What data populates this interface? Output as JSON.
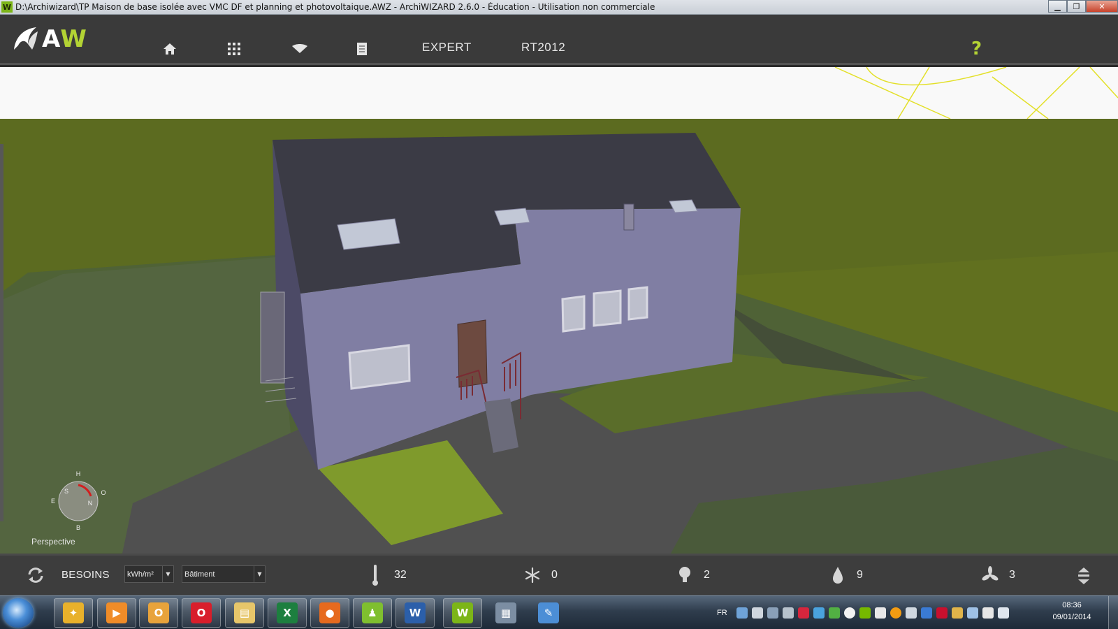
{
  "window": {
    "title": "D:\\Archiwizard\\TP Maison de base isolée avec VMC DF et planning et photovoltaique.AWZ  -  ArchiWIZARD 2.6.0 - Éducation - Utilisation non commerciale",
    "icon_letter": "W",
    "controls": {
      "minimize": "minimize-icon",
      "maximize": "maximize-icon",
      "close": "close-icon"
    }
  },
  "header": {
    "logo": {
      "letter_a": "A",
      "letter_w": "W"
    },
    "nav": [
      {
        "icon": "home-icon"
      },
      {
        "icon": "grid-icon"
      },
      {
        "icon": "eye-icon"
      },
      {
        "icon": "document-icon"
      },
      {
        "label": "EXPERT"
      },
      {
        "label": "RT2012"
      }
    ],
    "help": "?"
  },
  "viewport": {
    "compass": {
      "top": "H",
      "bottom": "B",
      "left": "E",
      "right": "O",
      "inner_s": "S",
      "inner_n": "N"
    },
    "view_label": "Perspective"
  },
  "bottom_bar": {
    "refresh_icon": "refresh-icon",
    "title": "BESOINS",
    "unit_select": "kWh/m²",
    "scope_select": "Bâtiment",
    "stats": [
      {
        "icon": "thermometer-icon",
        "value": "32"
      },
      {
        "icon": "snowflake-icon",
        "value": "0"
      },
      {
        "icon": "lightbulb-icon",
        "value": "2"
      },
      {
        "icon": "water-drop-icon",
        "value": "9"
      },
      {
        "icon": "fan-icon",
        "value": "3"
      }
    ],
    "expand_icon": "expand-icon"
  },
  "taskbar": {
    "apps": [
      {
        "name": "games",
        "letter": "✦",
        "color": "#e8b12b"
      },
      {
        "name": "media-player",
        "letter": "▶",
        "color": "#f08c28"
      },
      {
        "name": "outlook",
        "letter": "O",
        "color": "#e8a33b"
      },
      {
        "name": "opera",
        "letter": "O",
        "color": "#d81e2b"
      },
      {
        "name": "explorer",
        "letter": "▤",
        "color": "#e7c66a"
      },
      {
        "name": "excel",
        "letter": "X",
        "color": "#1d7f3f"
      },
      {
        "name": "firefox",
        "letter": "●",
        "color": "#e66a1e"
      },
      {
        "name": "contacts",
        "letter": "♟",
        "color": "#7fbf2f"
      },
      {
        "name": "word",
        "letter": "W",
        "color": "#2b5faa"
      },
      {
        "name": "archiwizard",
        "letter": "W",
        "color": "#7cb518"
      },
      {
        "name": "notes",
        "letter": "▦",
        "color": "#7c8ea3"
      },
      {
        "name": "paint",
        "letter": "✎",
        "color": "#4c8ed6"
      }
    ],
    "tray": {
      "language": "FR",
      "clock_time": "08:36",
      "clock_date": "09/01/2014"
    }
  }
}
